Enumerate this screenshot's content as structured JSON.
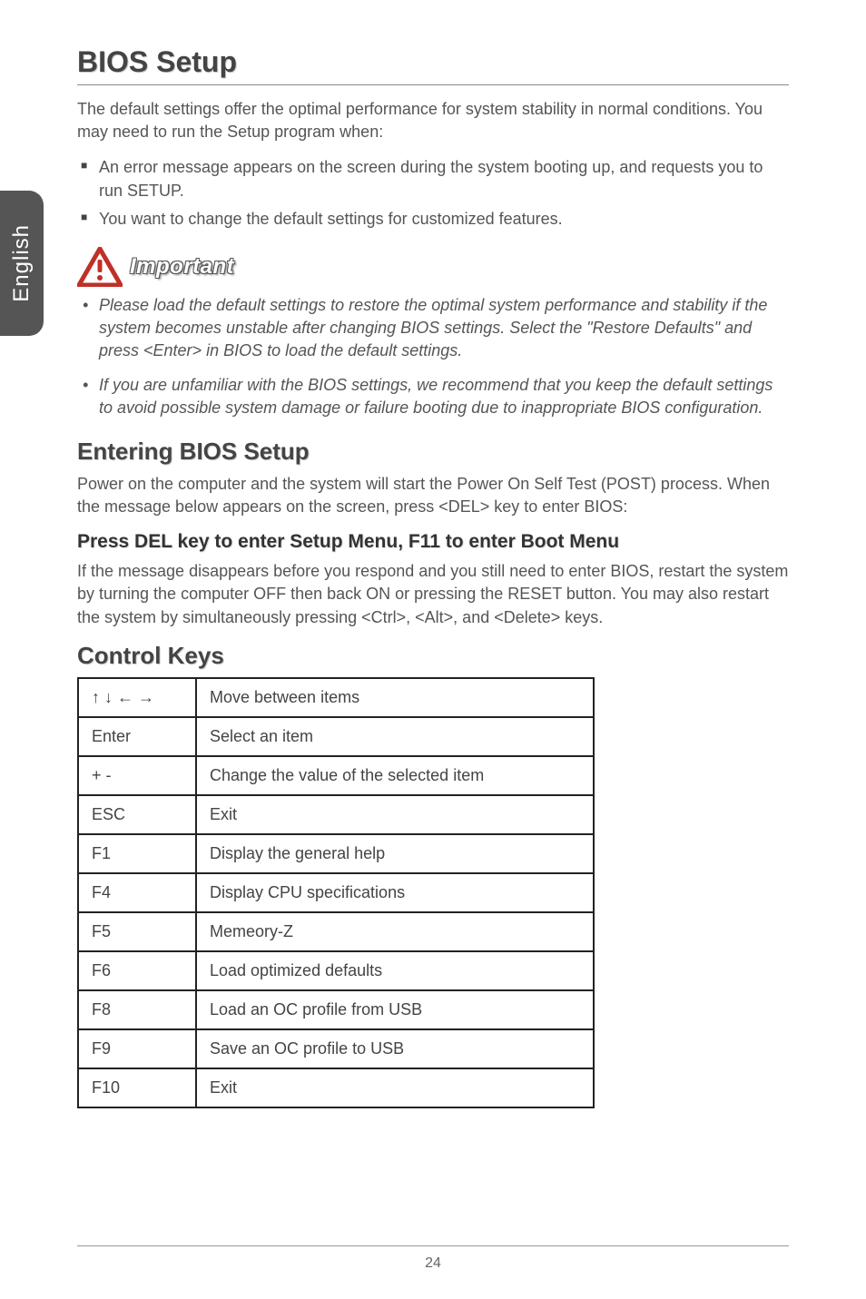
{
  "sideTab": "English",
  "title": "BIOS Setup",
  "intro": "The default settings offer the optimal performance for system stability in normal conditions. You may need to run the Setup program when:",
  "bullets": [
    "An error message appears on the screen during the system booting up, and requests you to run SETUP.",
    "You want to change the default settings for customized features."
  ],
  "importantLabel": "Important",
  "importantItems": [
    "Please load the default settings to restore the optimal system performance and stability if the system becomes unstable after changing BIOS settings. Select the \"Restore Defaults\" and press <Enter> in BIOS to load the default settings.",
    "If you are unfamiliar with the BIOS settings, we recommend that you keep the default settings to avoid possible system damage or failure booting due to inappropriate BIOS configuration."
  ],
  "section1": {
    "heading": "Entering BIOS Setup",
    "para": "Power on the computer and the system will start the Power On Self Test (POST) process. When the message below appears on the screen, press <DEL> key to enter BIOS:",
    "subheading": "Press DEL key to enter Setup Menu, F11 to enter Boot Menu",
    "para2": "If the message disappears before you respond and you still need to enter BIOS, restart the system by turning the computer OFF then back ON or pressing the RESET button. You may also restart the system by simultaneously pressing <Ctrl>, <Alt>, and <Delete> keys."
  },
  "section2": {
    "heading": "Control Keys",
    "rows": [
      {
        "key": "↑ ↓ ← →",
        "desc": "Move between items"
      },
      {
        "key": "Enter",
        "desc": "Select an item"
      },
      {
        "key": "+ -",
        "desc": "Change the value of the selected item"
      },
      {
        "key": "ESC",
        "desc": "Exit"
      },
      {
        "key": "F1",
        "desc": "Display the general help"
      },
      {
        "key": "F4",
        "desc": "Display CPU specifications"
      },
      {
        "key": "F5",
        "desc": "Memeory-Z"
      },
      {
        "key": "F6",
        "desc": "Load optimized defaults"
      },
      {
        "key": "F8",
        "desc": "Load an OC profile from USB"
      },
      {
        "key": "F9",
        "desc": "Save an OC profile to USB"
      },
      {
        "key": "F10",
        "desc": "Exit"
      }
    ]
  },
  "pageNum": "24"
}
